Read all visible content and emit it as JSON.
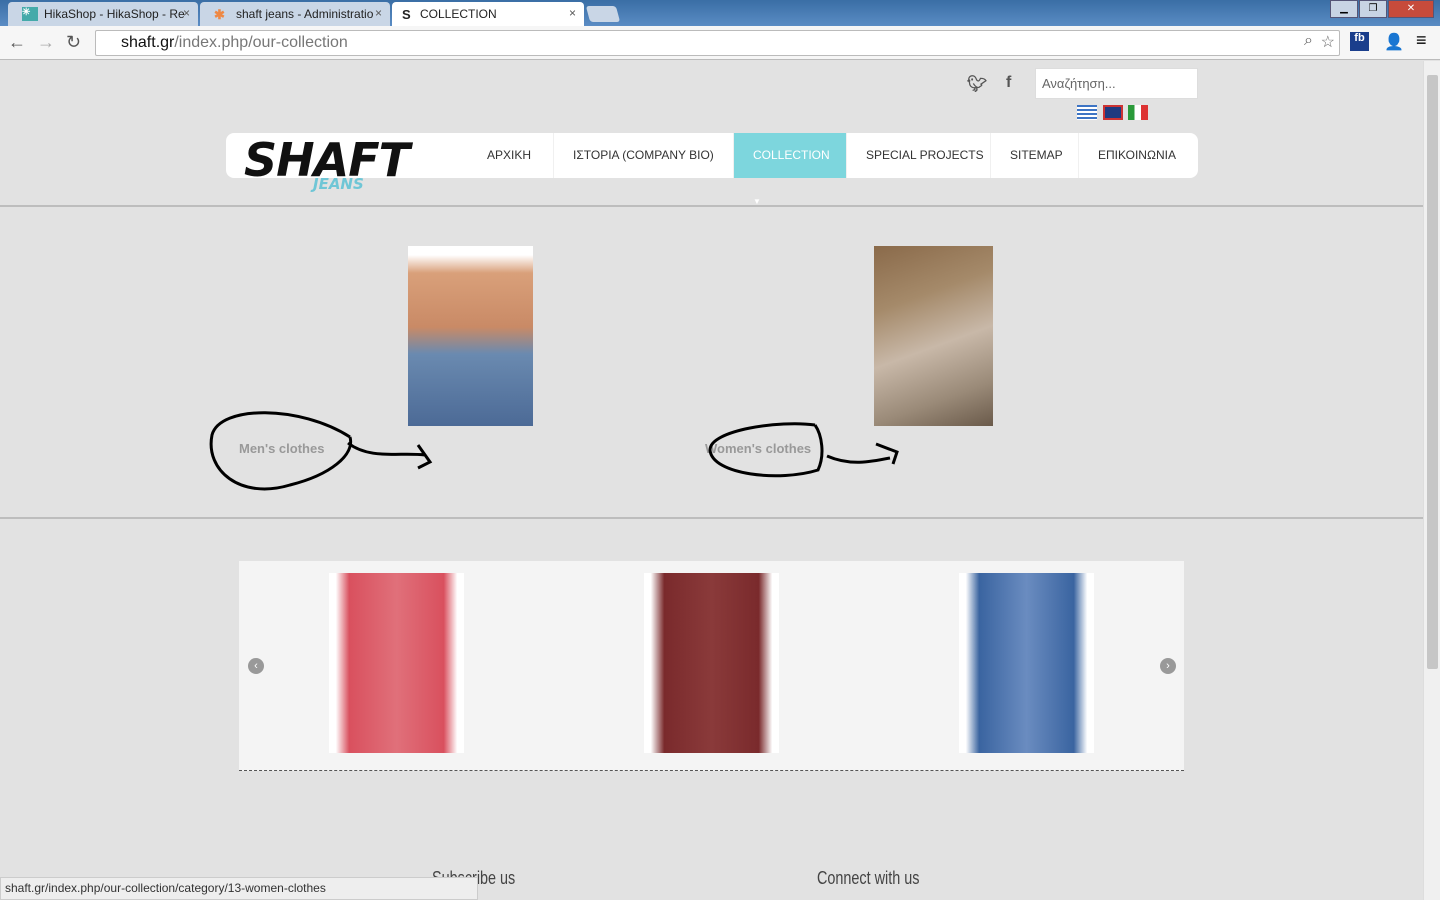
{
  "browser": {
    "tabs": [
      {
        "label": "HikaShop - HikaShop - Re"
      },
      {
        "label": "shaft jeans - Administratio"
      },
      {
        "label": "COLLECTION"
      }
    ],
    "url_domain": "shaft.gr",
    "url_path": "/index.php/our-collection",
    "status_url": "shaft.gr/index.php/our-collection/category/13-women-clothes"
  },
  "header": {
    "search_placeholder": "Αναζήτηση...",
    "logo": "SHAFT",
    "logo_sub": "JEANS",
    "menu": [
      {
        "label": "ΑΡΧΙΚΗ"
      },
      {
        "label": "ΙΣΤΟΡΙΑ (COMPANY BIO)"
      },
      {
        "label": "COLLECTION",
        "active": true
      },
      {
        "label": "SPECIAL PROJECTS"
      },
      {
        "label": "SITEMAP"
      },
      {
        "label": "ΕΠΙΚΟΙΝΩΝΙΑ"
      }
    ],
    "accent": "#7dd6dd"
  },
  "categories": [
    {
      "label": "Men's clothes"
    },
    {
      "label": "Women's clothes"
    }
  ],
  "carousel": {
    "items": [
      {
        "color": "#d9505e"
      },
      {
        "color": "#7a2a2c"
      },
      {
        "color": "#3a64a0"
      }
    ]
  },
  "footer": {
    "subscribe": "Subscribe us",
    "connect": "Connect with us"
  }
}
